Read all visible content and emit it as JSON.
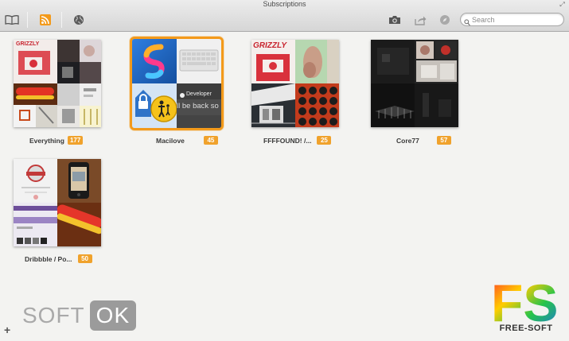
{
  "window": {
    "title": "Subscriptions"
  },
  "toolbar": {
    "left_icons": [
      "book-icon",
      "rss-icon",
      "globe-icon"
    ],
    "right_icons": [
      "camera-icon",
      "share-icon",
      "compass-icon"
    ],
    "search_placeholder": "Search"
  },
  "subscriptions": [
    {
      "name": "Everything",
      "count": "177",
      "selected": false
    },
    {
      "name": "Macilove",
      "count": "45",
      "selected": true
    },
    {
      "name": "FFFFOUND! /...",
      "count": "25",
      "selected": false
    },
    {
      "name": "Core77",
      "count": "57",
      "selected": false
    },
    {
      "name": "Dribbble / Po...",
      "count": "50",
      "selected": false
    }
  ],
  "thumbnail_text": {
    "grizzly": "GRIZZLY",
    "developer": "Developer",
    "back_soon": "ll be back so"
  },
  "watermarks": {
    "softok_left": "SOFT",
    "softok_right": "OK",
    "freesoft_mark": "FS",
    "freesoft_text": "FREE-SOFT"
  },
  "colors": {
    "accent": "#f39a1b",
    "badge": "#f0a22c"
  }
}
